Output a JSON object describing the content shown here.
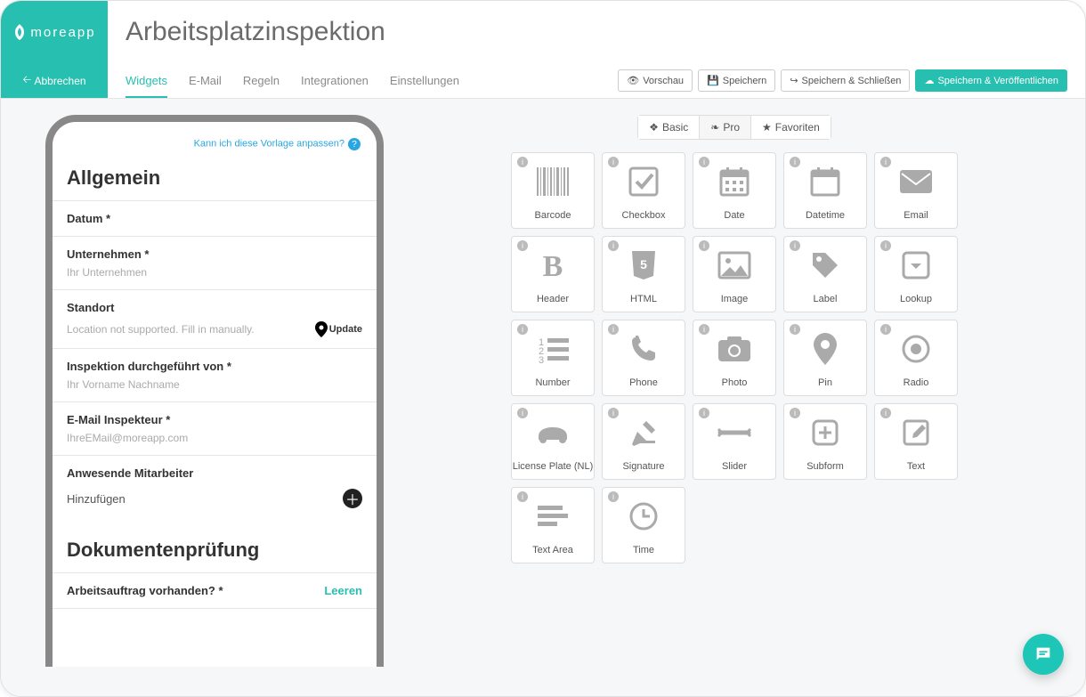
{
  "brand": {
    "name": "moreapp"
  },
  "header": {
    "title": "Arbeitsplatzinspektion",
    "cancel": "Abbrechen"
  },
  "tabs": [
    "Widgets",
    "E-Mail",
    "Regeln",
    "Integrationen",
    "Einstellungen"
  ],
  "active_tab": 0,
  "actions": {
    "preview": "Vorschau",
    "save": "Speichern",
    "save_close": "Speichern & Schließen",
    "save_publish": "Speichern & Veröffentlichen"
  },
  "preview": {
    "help_link": "Kann ich diese Vorlage anpassen?",
    "sections": [
      {
        "title": "Allgemein",
        "fields": [
          {
            "label": "Datum *",
            "placeholder": ""
          },
          {
            "label": "Unternehmen *",
            "placeholder": "Ihr Unternehmen"
          },
          {
            "label": "Standort",
            "placeholder": "Location not supported. Fill in manually.",
            "type": "location",
            "action": "Update"
          },
          {
            "label": "Inspektion durchgeführt von *",
            "placeholder": "Ihr Vorname Nachname"
          },
          {
            "label": "E-Mail Inspekteur *",
            "placeholder": "IhreEMail@moreapp.com"
          },
          {
            "label": "Anwesende Mitarbeiter",
            "type": "add",
            "add_text": "Hinzufügen"
          }
        ]
      },
      {
        "title": "Dokumentenprüfung",
        "fields": [
          {
            "label": "Arbeitsauftrag vorhanden? *",
            "type": "clearable",
            "clear": "Leeren"
          }
        ]
      }
    ]
  },
  "widget_tabs": {
    "basic": "Basic",
    "pro": "Pro",
    "favorites": "Favoriten",
    "active": "pro"
  },
  "widgets": [
    "Barcode",
    "Checkbox",
    "Date",
    "Datetime",
    "Email",
    "Header",
    "HTML",
    "Image",
    "Label",
    "Lookup",
    "Number",
    "Phone",
    "Photo",
    "Pin",
    "Radio",
    "License Plate (NL)",
    "Signature",
    "Slider",
    "Subform",
    "Text",
    "Text Area",
    "Time"
  ]
}
